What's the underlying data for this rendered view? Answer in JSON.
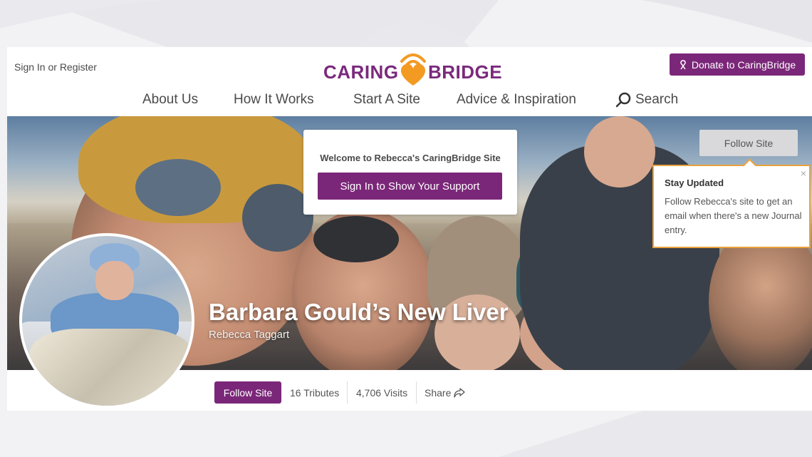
{
  "header": {
    "signin_label": "Sign In or Register",
    "logo_left": "CARING",
    "logo_right": "BRIDGE",
    "donate_label": "Donate to CaringBridge",
    "brand_color": "#7b2779",
    "accent_color": "#f39a23"
  },
  "nav": {
    "about": "About Us",
    "how": "How It Works",
    "start": "Start A Site",
    "advice": "Advice & Inspiration",
    "search": "Search"
  },
  "hero": {
    "welcome_text": "Welcome to Rebecca's CaringBridge Site",
    "welcome_button": "Sign In to Show Your Support",
    "follow_label": "Follow Site",
    "title": "Barbara Gould’s New Liver",
    "author": "Rebecca Taggart"
  },
  "tooltip": {
    "title": "Stay Updated",
    "body": "Follow Rebecca's site to get an email when there's a new Journal entry.",
    "close": "×",
    "border_color": "#e9a23b"
  },
  "actions": {
    "follow_label": "Follow Site",
    "tributes": "16 Tributes",
    "visits": "4,706 Visits",
    "share_label": "Share"
  },
  "icons": {
    "donate": "ribbon-icon",
    "search": "search-icon",
    "share": "share-icon",
    "close": "close-icon",
    "logo": "heart-signal-icon"
  }
}
